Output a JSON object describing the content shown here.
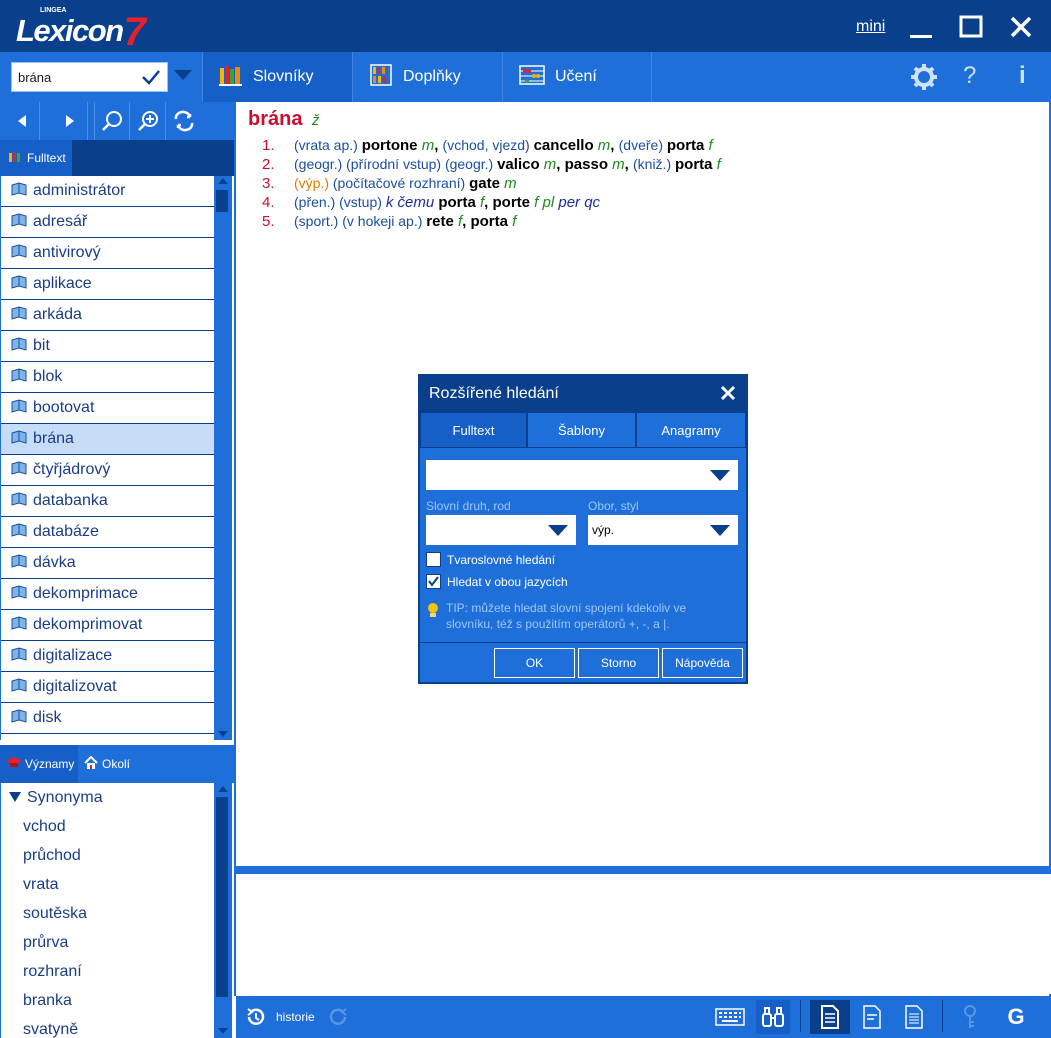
{
  "app": {
    "brand": "Lexicon",
    "brand_number": "7",
    "brand_maker": "LINGEA"
  },
  "window": {
    "mini_label": "mini"
  },
  "search": {
    "value": "brána"
  },
  "tabs": [
    {
      "label": "Slovníky",
      "icon": "books-icon"
    },
    {
      "label": "Doplňky",
      "icon": "bookshelf-icon"
    },
    {
      "label": "Učení",
      "icon": "abacus-icon"
    }
  ],
  "left": {
    "fulltext_tab": "Fulltext",
    "words": [
      "administrátor",
      "adresář",
      "antivirový",
      "aplikace",
      "arkáda",
      "bit",
      "blok",
      "bootovat",
      "brána",
      "čtyřjádrový",
      "databanka",
      "databáze",
      "dávka",
      "dekomprimace",
      "dekomprimovat",
      "digitalizace",
      "digitalizovat",
      "disk"
    ],
    "selected_word": "brána",
    "mid_tabs": {
      "vyznamy": "Významy",
      "okoli": "Okolí"
    },
    "synonyms_header": "Synonyma",
    "synonyms": [
      "vchod",
      "průchod",
      "vrata",
      "soutěska",
      "průrva",
      "rozhraní",
      "branka",
      "svatyně"
    ]
  },
  "entry": {
    "headword": "brána",
    "pos": "ž",
    "senses": [
      {
        "n": "1.",
        "parts": [
          [
            "g",
            "(vrata ap.) "
          ],
          [
            "b",
            "portone"
          ],
          [
            "gr",
            " m"
          ],
          [
            "b",
            ", "
          ],
          [
            "g",
            "(vchod, vjezd) "
          ],
          [
            "b",
            "cancello"
          ],
          [
            "gr",
            " m"
          ],
          [
            "b",
            ", "
          ],
          [
            "g",
            "(dveře) "
          ],
          [
            "b",
            "porta"
          ],
          [
            "gr",
            " f"
          ]
        ]
      },
      {
        "n": "2.",
        "parts": [
          [
            "g",
            "(geogr.)  (přírodní vstup) (geogr.) "
          ],
          [
            "b",
            "valico"
          ],
          [
            "gr",
            " m"
          ],
          [
            "b",
            ", passo"
          ],
          [
            "gr",
            " m"
          ],
          [
            "b",
            ", "
          ],
          [
            "g",
            "(kniž.) "
          ],
          [
            "b",
            "porta"
          ],
          [
            "gr",
            " f"
          ]
        ]
      },
      {
        "n": "3.",
        "parts": [
          [
            "o",
            "(výp.)"
          ],
          [
            "g",
            "  (počítačové rozhraní) "
          ],
          [
            "b",
            "gate"
          ],
          [
            "gr",
            " m"
          ]
        ]
      },
      {
        "n": "4.",
        "parts": [
          [
            "g",
            "(přen.)  (vstup) "
          ],
          [
            "it",
            "k čemu "
          ],
          [
            "b",
            "porta"
          ],
          [
            "gr",
            " f"
          ],
          [
            "b",
            ", porte"
          ],
          [
            "gr",
            " f pl"
          ],
          [
            "it",
            " per qc"
          ]
        ]
      },
      {
        "n": "5.",
        "parts": [
          [
            "g",
            "(sport.)  (v hokeji ap.) "
          ],
          [
            "b",
            "rete"
          ],
          [
            "gr",
            " f"
          ],
          [
            "b",
            ", porta"
          ],
          [
            "gr",
            " f"
          ]
        ]
      }
    ]
  },
  "dialog": {
    "title": "Rozšířené hledání",
    "tabs": [
      "Fulltext",
      "Šablony",
      "Anagramy"
    ],
    "search_value": "",
    "pos_label": "Slovní druh, rod",
    "pos_value": "",
    "field_label": "Obor, styl",
    "field_value": "výp.",
    "chk_morph": {
      "label": "Tvaroslovné hledání",
      "checked": false
    },
    "chk_both": {
      "label": "Hledat v obou jazycích",
      "checked": true
    },
    "tip": "TIP: můžete hledat slovní spojení kdekoliv ve slovníku, též s použitím operátorů +, -,  a |.",
    "buttons": {
      "ok": "OK",
      "cancel": "Storno",
      "help": "Nápověda"
    }
  },
  "status": {
    "history_label": "historie"
  },
  "colors": {
    "dark": "#0a3f8c",
    "primary": "#1e6fd9",
    "headword": "#c8102e",
    "gender": "#1e8a1e"
  }
}
